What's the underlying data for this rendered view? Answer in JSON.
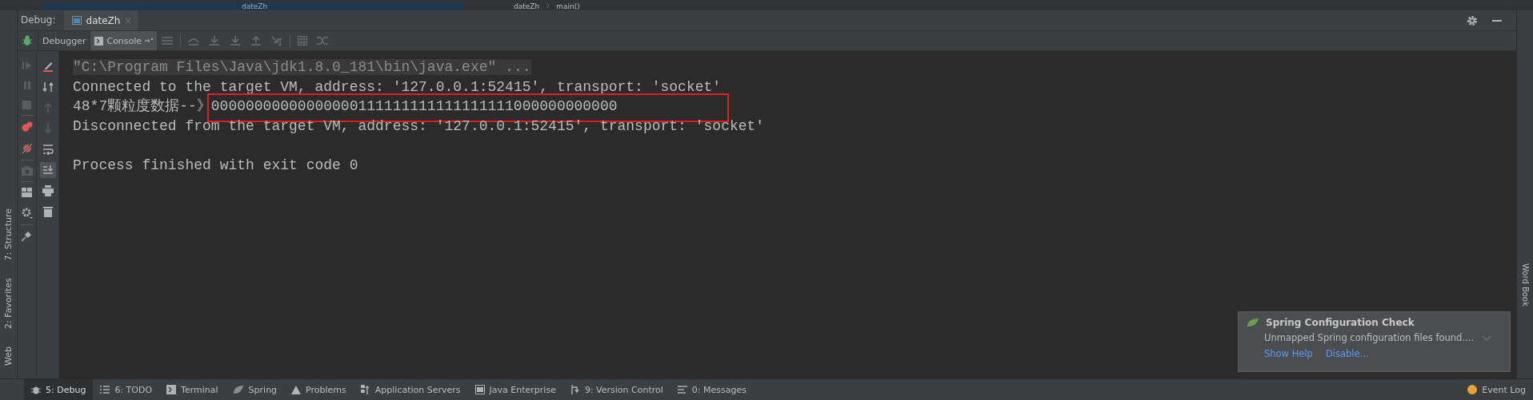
{
  "top_strip": {
    "file_tab": "dateZh",
    "breadcrumb": [
      "dateZh",
      "main()"
    ]
  },
  "debug_header": {
    "label": "Debug:",
    "tabs": [
      {
        "label": "dateZh",
        "selected": true
      }
    ]
  },
  "toolbar": {
    "tabs": [
      {
        "label": "Debugger",
        "selected": false
      },
      {
        "label": "Console",
        "selected": true
      }
    ]
  },
  "left_stripe": [
    "7: Structure",
    "2: Favorites",
    "Web"
  ],
  "console": {
    "lines": [
      {
        "kind": "command",
        "text": "\"C:\\Program Files\\Java\\jdk1.8.0_181\\bin\\java.exe\" ..."
      },
      {
        "kind": "output",
        "text": "Connected to the target VM, address: '127.0.0.1:52415', transport: 'socket'"
      },
      {
        "kind": "output",
        "text": "48*7颗粒度数据--》00000000000000000111111111111111111000000000000",
        "marked": true
      },
      {
        "kind": "output",
        "text": "Disconnected from the target VM, address: '127.0.0.1:52415', transport: 'socket'"
      },
      {
        "kind": "blank"
      },
      {
        "kind": "output",
        "text": "Process finished with exit code 0"
      }
    ]
  },
  "right_stripe": [
    "Word Book"
  ],
  "notification": {
    "title": "Spring Configuration Check",
    "message": "Unmapped Spring configuration files found....",
    "actions": [
      "Show Help",
      "Disable..."
    ]
  },
  "status_bar": {
    "items": [
      {
        "label": "5: Debug",
        "selected": true
      },
      {
        "label": "6: TODO",
        "selected": false
      },
      {
        "label": "Terminal",
        "selected": false
      },
      {
        "label": "Spring",
        "selected": false
      },
      {
        "label": "Problems",
        "selected": false
      },
      {
        "label": "Application Servers",
        "selected": false
      },
      {
        "label": "Java Enterprise",
        "selected": false
      },
      {
        "label": "9: Version Control",
        "selected": false
      },
      {
        "label": "0: Messages",
        "selected": false
      }
    ],
    "right": "Event Log"
  }
}
